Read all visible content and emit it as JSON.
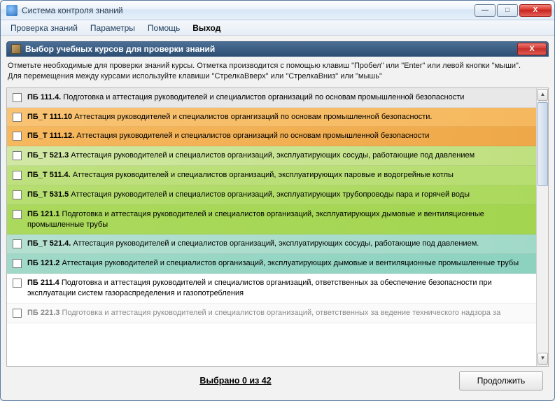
{
  "window": {
    "title": "Система контроля знаний"
  },
  "menu": {
    "check": "Проверка знаний",
    "params": "Параметры",
    "help": "Помощь",
    "exit": "Выход"
  },
  "panel": {
    "title": "Выбор учебных курсов для проверки знаний",
    "close_label": "X"
  },
  "instructions": {
    "line1": "Отметьте необходимые для проверки знаний курсы. Отметка производится с помощью клавиш \"Пробел\" или \"Enter\" или левой кнопки \"мыши\".",
    "line2": "Для перемещения между курсами используйте клавиши \"СтрелкаВверх\" или \"СтрелкаВниз\" или \"мышь\""
  },
  "courses": [
    {
      "code": "ПБ 111.4.",
      "text": "Подготовка и аттестация руководителей и специалистов организаций по основам промышленной безопасности",
      "bg": "bg-grey"
    },
    {
      "code": "ПБ_Т 111.10",
      "text": "Аттестация руководителей и специалистов органгизаций по основам промышленной безопасности.",
      "bg": "bg-orange1"
    },
    {
      "code": "ПБ_Т 111.12.",
      "text": "Аттестация руководителей и специалистов организаций по основам промышленной безопасности",
      "bg": "bg-orange2"
    },
    {
      "code": "ПБ_Т 521.3",
      "text": "Аттестация руководителей и специалистов организаций, эксплуатирующих сосуды, работающие под давлением",
      "bg": "bg-green1"
    },
    {
      "code": "ПБ_Т 511.4.",
      "text": "Аттестация руководителей и специалистов организаций, эксплуатирующих паровые и водогрейные котлы",
      "bg": "bg-green2"
    },
    {
      "code": "ПБ_Т 531.5",
      "text": "Аттестация руководителей и специалистов организаций, эксплуатирующих трубопроводы пара и горячей воды",
      "bg": "bg-green3"
    },
    {
      "code": "ПБ 121.1",
      "text": "Подготовка и аттестация руководителей и специалистов организаций, эксплуатирующих дымовые и вентиляционные промышленные трубы",
      "bg": "bg-green4"
    },
    {
      "code": "ПБ_Т 521.4.",
      "text": "Аттестация руководителей и специалистов организаций, эксплуатирующих сосуды, работающие под давлением.",
      "bg": "bg-teal1"
    },
    {
      "code": "ПБ 121.2",
      "text": "Аттестация руководителей и специалистов организаций, эксплуатирующих  дымовые и вентиляционные промышленные трубы",
      "bg": "bg-teal2"
    },
    {
      "code": "ПБ 211.4",
      "text": "Подготовка и аттестация руководителей и специалистов организаций, ответственных за обеспечение безопасности при эксплуатации систем газораспределения и газопотребления",
      "bg": "bg-white"
    },
    {
      "code": "ПБ 221.3",
      "text": "Подготовка и аттестация руководителей и специалистов организаций, ответственных за ведение технического надзора за",
      "bg": "bg-white2",
      "partial": true
    }
  ],
  "footer": {
    "status": "Выбрано 0 из 42",
    "continue": "Продолжить"
  },
  "win_controls": {
    "min": "—",
    "max": "□",
    "close": "X"
  }
}
